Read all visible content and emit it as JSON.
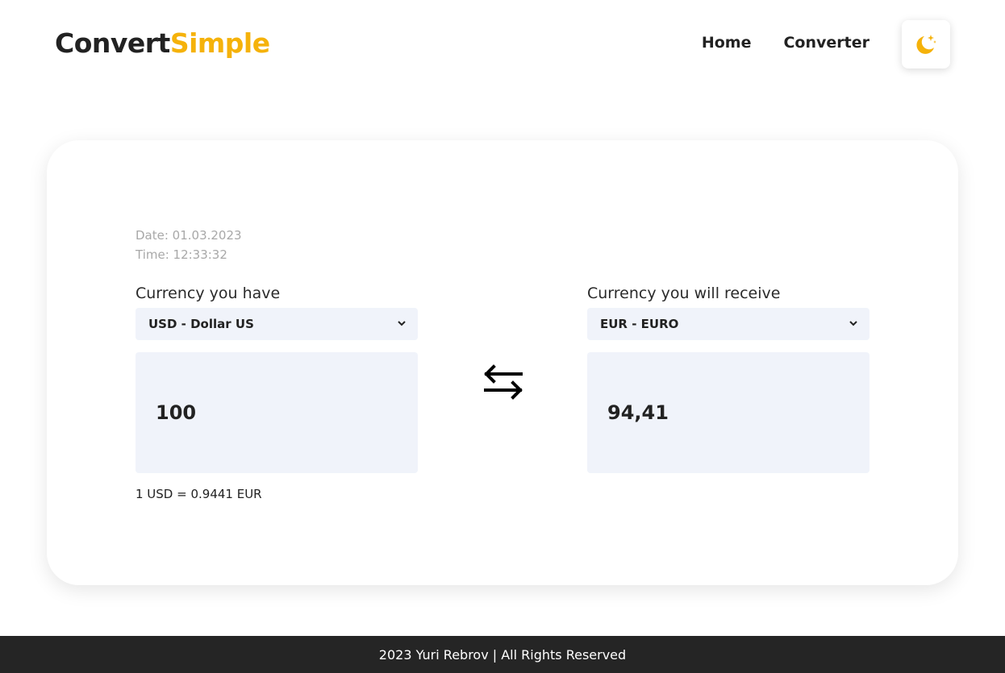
{
  "header": {
    "logo_part1": "Convert",
    "logo_part2": "Simple",
    "nav": {
      "home": "Home",
      "converter": "Converter"
    },
    "theme_icon": "moon-stars-icon"
  },
  "converter": {
    "date": "Date: 01.03.2023",
    "time": "Time: 12:33:32",
    "from": {
      "label": "Currency you have",
      "currency": "USD - Dollar US",
      "amount": "100"
    },
    "to": {
      "label": "Currency you will receive",
      "currency": "EUR - EURO",
      "amount": "94,41"
    },
    "rate": "1 USD = 0.9441 EUR",
    "swap_icon": "swap-arrows-icon"
  },
  "footer": {
    "text": "2023 Yuri Rebrov | All Rights Reserved"
  },
  "colors": {
    "accent": "#f5b20a",
    "dark": "#222222",
    "field_bg": "#f0f3fa",
    "footer_bg": "#252525"
  }
}
